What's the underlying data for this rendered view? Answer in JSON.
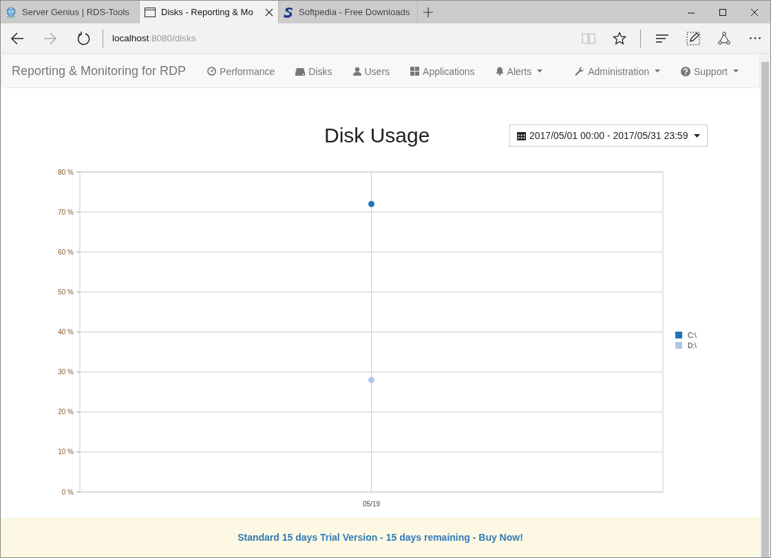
{
  "browser": {
    "tabs": [
      {
        "label": "Server Genius | RDS-Tools",
        "selected": false,
        "closable": false
      },
      {
        "label": "Disks - Reporting & Mo",
        "selected": true,
        "closable": true
      },
      {
        "label": "Softpedia - Free Downloads",
        "selected": false,
        "closable": false
      }
    ],
    "address": {
      "host": "localhost",
      "path": ":8080/disks"
    }
  },
  "navbar": {
    "brand": "Reporting & Monitoring for RDP",
    "items": [
      {
        "label": "Performance",
        "dropdown": false
      },
      {
        "label": "Disks",
        "dropdown": false
      },
      {
        "label": "Users",
        "dropdown": false
      },
      {
        "label": "Applications",
        "dropdown": false
      },
      {
        "label": "Alerts",
        "dropdown": true
      }
    ],
    "right_items": [
      {
        "label": "Administration",
        "dropdown": true
      },
      {
        "label": "Support",
        "dropdown": true
      }
    ]
  },
  "page": {
    "title": "Disk Usage",
    "date_range": "2017/05/01 00:00 - 2017/05/31 23:59",
    "chart_data": {
      "type": "scatter",
      "grid": true,
      "legend": true,
      "categories": [
        "05/19"
      ],
      "ylim": [
        0,
        80
      ],
      "yticks": [
        {
          "value": 0,
          "label": "0 %"
        },
        {
          "value": 10,
          "label": "10 %"
        },
        {
          "value": 20,
          "label": "20 %"
        },
        {
          "value": 30,
          "label": "30 %"
        },
        {
          "value": 40,
          "label": "40 %"
        },
        {
          "value": 50,
          "label": "50 %"
        },
        {
          "value": 60,
          "label": "60 %"
        },
        {
          "value": 70,
          "label": "70 %"
        },
        {
          "value": 80,
          "label": "80 %"
        }
      ],
      "series": [
        {
          "name": "C:\\",
          "color": "#1f77b4",
          "values": [
            72
          ]
        },
        {
          "name": "D:\\",
          "color": "#aec7e8",
          "values": [
            28
          ]
        }
      ]
    }
  },
  "footer": {
    "text": "Standard 15 days Trial Version - 15 days remaining - Buy Now!"
  }
}
